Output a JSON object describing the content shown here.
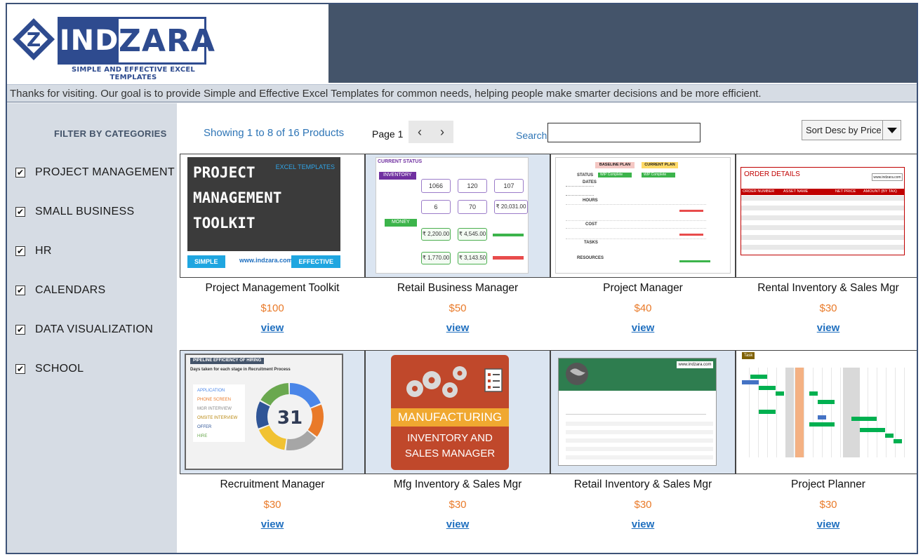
{
  "header": {
    "logo_ind": "IND",
    "logo_zara": "ZARA",
    "logo_mark": "Z",
    "tagline": "SIMPLE AND EFFECTIVE EXCEL TEMPLATES",
    "welcome": "Thanks for visiting. Our goal is to provide Simple and Effective Excel Templates for common needs, helping people make smarter decisions and be more efficient."
  },
  "sidebar": {
    "title": "FILTER BY CATEGORIES",
    "categories": [
      {
        "label": "PROJECT MANAGEMENT",
        "checked": "✔"
      },
      {
        "label": "SMALL BUSINESS",
        "checked": "✔"
      },
      {
        "label": "HR",
        "checked": "✔"
      },
      {
        "label": "CALENDARS",
        "checked": "✔"
      },
      {
        "label": "DATA VISUALIZATION",
        "checked": "✔"
      },
      {
        "label": "SCHOOL",
        "checked": "✔"
      }
    ]
  },
  "toolbar": {
    "showing": "Showing 1 to 8 of 16 Products",
    "page": "Page 1",
    "prev": "‹",
    "next": "›",
    "search_label": "Search",
    "search_value": "",
    "sort_selected": "Sort Desc by Price"
  },
  "products": [
    {
      "name": "Project Management Toolkit",
      "price": "$100",
      "link": "view"
    },
    {
      "name": "Retail Business Manager",
      "price": "$50",
      "link": "view"
    },
    {
      "name": "Project Manager",
      "price": "$40",
      "link": "view"
    },
    {
      "name": "Rental Inventory & Sales Mgr",
      "price": "$30",
      "link": "view"
    },
    {
      "name": "Recruitment Manager",
      "price": "$30",
      "link": "view"
    },
    {
      "name": "Mfg Inventory & Sales Mgr",
      "price": "$30",
      "link": "view"
    },
    {
      "name": "Retail Inventory & Sales Mgr",
      "price": "$30",
      "link": "view"
    },
    {
      "name": "Project Planner",
      "price": "$30",
      "link": "view"
    }
  ],
  "thumbs": {
    "pm": {
      "line1": "PROJECT",
      "line2": "MANAGEMENT",
      "line3": "TOOLKIT",
      "tag": "EXCEL TEMPLATES",
      "simple": "SIMPLE",
      "url": "www.indzara.com",
      "effective": "EFFECTIVE"
    },
    "retail": {
      "status": "CURRENT STATUS",
      "inventory": "INVENTORY",
      "money": "MONEY",
      "k1": "1066",
      "k2": "120",
      "k3": "107",
      "k4": "6",
      "k5": "70",
      "k6": "₹ 20,031.00",
      "m1": "₹ 2,200.00",
      "m2": "₹ 4,545.00",
      "m3": "₹ 1,770.00",
      "m4": "₹ 3,143.50"
    },
    "pmgr": {
      "baseline": "BASELINE PLAN",
      "current": "CURRENT PLAN",
      "status": "STATUS",
      "complete": "WIP Complete",
      "dates": "DATES",
      "hours": "HOURS",
      "cost": "COST",
      "tasks": "TASKS",
      "resources": "RESOURCES"
    },
    "rental": {
      "title": "ORDER DETAILS",
      "col1": "ORDER NUMBER",
      "col2": "ASSET NAME",
      "col3": "NET PRICE",
      "col4": "AMOUNT (BY TAX)",
      "site": "www.indzara.com"
    },
    "recruit": {
      "title": "PIPELINE EFFICIENCY OF HIRING",
      "sub": "Days taken for each stage in Recruitment Process",
      "center": "31",
      "s1": "APPLICATION",
      "s2": "PHONE SCREEN",
      "s3": "MGR INTERVIEW",
      "s4": "ONSITE INTERVIEW",
      "s5": "OFFER",
      "s6": "HIRE"
    },
    "mfg": {
      "line1": "MANUFACTURING",
      "line2": "INVENTORY AND",
      "line3": "SALES MANAGER"
    },
    "retinv": {
      "site": "www.indzara.com"
    },
    "planner": {
      "tag": "Task"
    }
  }
}
